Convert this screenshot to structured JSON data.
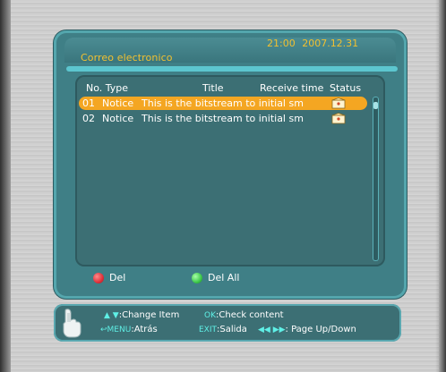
{
  "window": {
    "title": "Correo electronico",
    "clock": "21:00  2007.12.31"
  },
  "list": {
    "columns": {
      "no_type": "No. Type",
      "title": "Title",
      "receive_time": "Receive time",
      "status": "Status"
    },
    "rows": [
      {
        "no": "01",
        "type": "Notice",
        "title": "This is the bitstream to initial sm",
        "status_icon": "envelope-icon",
        "selected": true
      },
      {
        "no": "02",
        "type": "Notice",
        "title": "This is the bitstream to initial sm",
        "status_icon": "envelope-icon",
        "selected": false
      }
    ]
  },
  "keys": {
    "red_label": "Del",
    "red_color": "#e0303a",
    "green_label": "Del All",
    "green_color": "#3ec84a"
  },
  "help": {
    "updown_keys": "▲ ▼",
    "change_item": ":Change Item",
    "ok_key": "OK",
    "check_content": ":Check content",
    "menu_key": "MENU",
    "menu_action": ":Atrás",
    "exit_key": "EXIT",
    "exit_action": ":Salida",
    "page_keys": "◀◀ ▶▶",
    "page_action": ": Page Up/Down"
  },
  "colors": {
    "accent": "#f2c030",
    "selection": "#f4a622",
    "panel": "#3f7f86"
  }
}
